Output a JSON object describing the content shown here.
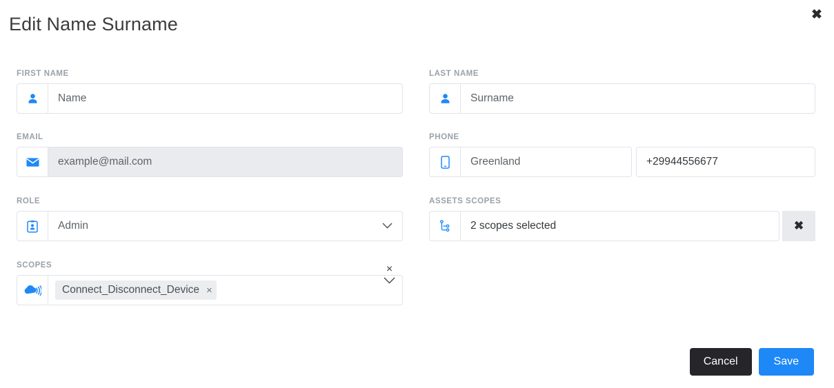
{
  "dialog": {
    "title": "Edit Name Surname",
    "close_label": "✖",
    "close_icon": "close-icon"
  },
  "fields": {
    "first_name": {
      "label": "FIRST NAME",
      "placeholder": "Name",
      "value": "",
      "icon": "user-icon"
    },
    "last_name": {
      "label": "LAST NAME",
      "placeholder": "Surname",
      "value": "",
      "icon": "user-icon"
    },
    "email": {
      "label": "EMAIL",
      "placeholder": "example@mail.com",
      "value": "",
      "icon": "envelope-icon",
      "disabled": true
    },
    "phone": {
      "label": "PHONE",
      "country_placeholder": "Greenland",
      "number_value": "+29944556677",
      "icon": "mobile-phone-icon"
    },
    "role": {
      "label": "ROLE",
      "placeholder": "Admin",
      "selected": "Admin",
      "icon": "id-badge-icon",
      "chevron_icon": "chevron-down-icon"
    },
    "assets_scopes": {
      "label": "ASSETS SCOPES",
      "value": "2 scopes selected",
      "icon": "sitemap-icon",
      "clear_label": "✖",
      "clear_icon": "clear-icon"
    },
    "scopes": {
      "label": "SCOPES",
      "icon": "cloud-signal-icon",
      "chips": [
        {
          "label": "Connect_Disconnect_Device",
          "remove_label": "×"
        }
      ],
      "clear_label": "×",
      "clear_icon": "clear-icon",
      "chevron_icon": "chevron-down-icon"
    }
  },
  "footer": {
    "cancel_label": "Cancel",
    "save_label": "Save"
  },
  "colors": {
    "accent": "#1e88f7",
    "cancel_bg": "#26262a",
    "label": "#9aa1a9",
    "border": "#dfe3ea",
    "disabled_bg": "#e9ebee",
    "chip_bg": "#ebedef"
  }
}
